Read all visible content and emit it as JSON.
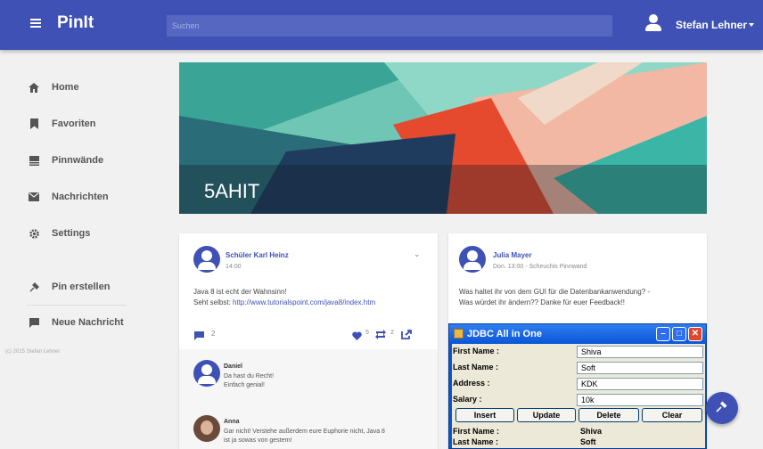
{
  "app": {
    "brand": "PinIt"
  },
  "search": {
    "placeholder": "Suchen"
  },
  "user": {
    "name": "Stefan Lehner"
  },
  "sidebar": {
    "items": [
      {
        "label": "Home",
        "icon": "home-icon"
      },
      {
        "label": "Favoriten",
        "icon": "bookmark-icon"
      },
      {
        "label": "Pinnwände",
        "icon": "board-icon"
      },
      {
        "label": "Nachrichten",
        "icon": "mail-icon"
      },
      {
        "label": "Settings",
        "icon": "gear-icon"
      },
      {
        "label": "Pin erstellen",
        "icon": "pin-icon"
      },
      {
        "label": "Neue Nachricht",
        "icon": "chat-icon"
      }
    ],
    "copyright": "(c) 2015 Stefan Lehner"
  },
  "hero": {
    "title": "5AHIT"
  },
  "post1": {
    "author": "Schüler Karl Heinz",
    "time": "14:00",
    "text_line1": "Java 8 ist echt der Wahnsinn!",
    "text_prefix": "Seht selbst: ",
    "link": "http://www.tutorialspoint.com/java8/index.htm",
    "comments": "2",
    "likes": "5",
    "reposts": "2",
    "comment1": {
      "author": "Daniel",
      "line1": "Da hast du Recht!",
      "line2": "Einfach genial!"
    },
    "comment2": {
      "author": "Anna",
      "line1": "Gar nicht! Verstehe außerdem eure Euphorie nicht, Java 8",
      "line2": "ist ja sowas von gestern!"
    }
  },
  "post2": {
    "author": "Julia Mayer",
    "meta": "Don. 13:00 - Scheuchis Pinnwand",
    "text_line1": "Was haltet ihr von dem GUI für die Datenbankanwendung? -",
    "text_line2": "Was würdet ihr ändern?? Danke für euer Feedback!!"
  },
  "jdbc": {
    "title": "JDBC All in One",
    "fields": [
      {
        "label": "First Name :",
        "value": "Shiva"
      },
      {
        "label": "Last Name :",
        "value": "Soft"
      },
      {
        "label": "Address :",
        "value": "KDK"
      },
      {
        "label": "Salary :",
        "value": "10k"
      }
    ],
    "buttons": [
      "Insert",
      "Update",
      "Delete",
      "Clear"
    ],
    "output": [
      {
        "label": "First Name :",
        "value": "Shiva"
      },
      {
        "label": "Last Name :",
        "value": "Soft"
      }
    ]
  },
  "colors": {
    "primary": "#3f51b5",
    "background": "#f1f1f1"
  }
}
